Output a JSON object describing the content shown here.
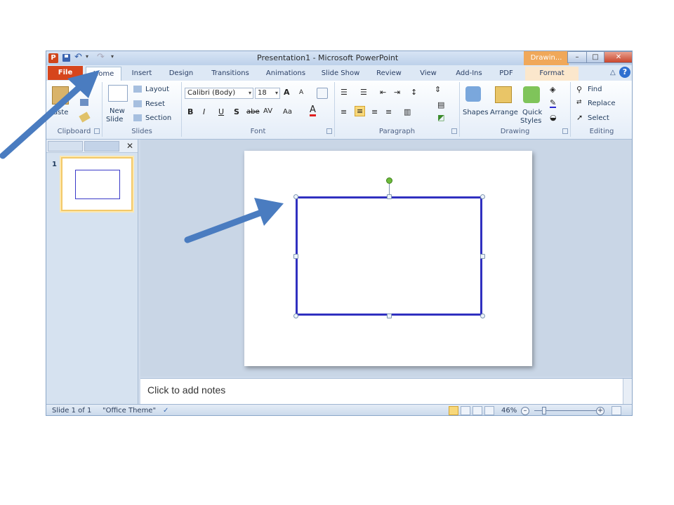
{
  "window": {
    "title": "Presentation1 - Microsoft PowerPoint",
    "context_tab_group": "Drawin...",
    "logo_letter": "P"
  },
  "tabs": [
    "File",
    "Home",
    "Insert",
    "Design",
    "Transitions",
    "Animations",
    "Slide Show",
    "Review",
    "View",
    "Add-Ins",
    "PDF",
    "Format"
  ],
  "active_tab": "Home",
  "ribbon": {
    "clipboard": {
      "paste": "aste",
      "label": "Clipboard"
    },
    "slides": {
      "new_slide": "New",
      "new_slide2": "Slide",
      "layout": "Layout",
      "reset": "Reset",
      "section": "Section",
      "label": "Slides"
    },
    "font": {
      "font_name": "Calibri (Body)",
      "font_size": "18",
      "bold": "B",
      "italic": "I",
      "underline": "U",
      "shadow": "S",
      "strike": "abe",
      "spacing": "AV",
      "case": "Aa",
      "color": "A",
      "grow": "A",
      "shrink": "A",
      "label": "Font"
    },
    "paragraph": {
      "label": "Paragraph"
    },
    "drawing": {
      "shapes": "Shapes",
      "arrange": "Arrange",
      "quick": "Quick",
      "styles": "Styles",
      "label": "Drawing"
    },
    "editing": {
      "find": "Find",
      "replace": "Replace",
      "select": "Select",
      "label": "Editing"
    }
  },
  "slide_panel": {
    "thumb_number": "1"
  },
  "notes": {
    "placeholder": "Click to add notes"
  },
  "status": {
    "slide": "Slide 1 of 1",
    "theme": "\"Office Theme\"",
    "zoom": "46%"
  },
  "colors": {
    "arrow": "#4a7cc0",
    "shape_border": "#3030c0",
    "file_tab": "#d6451c",
    "context_tab": "#f0a85a"
  }
}
